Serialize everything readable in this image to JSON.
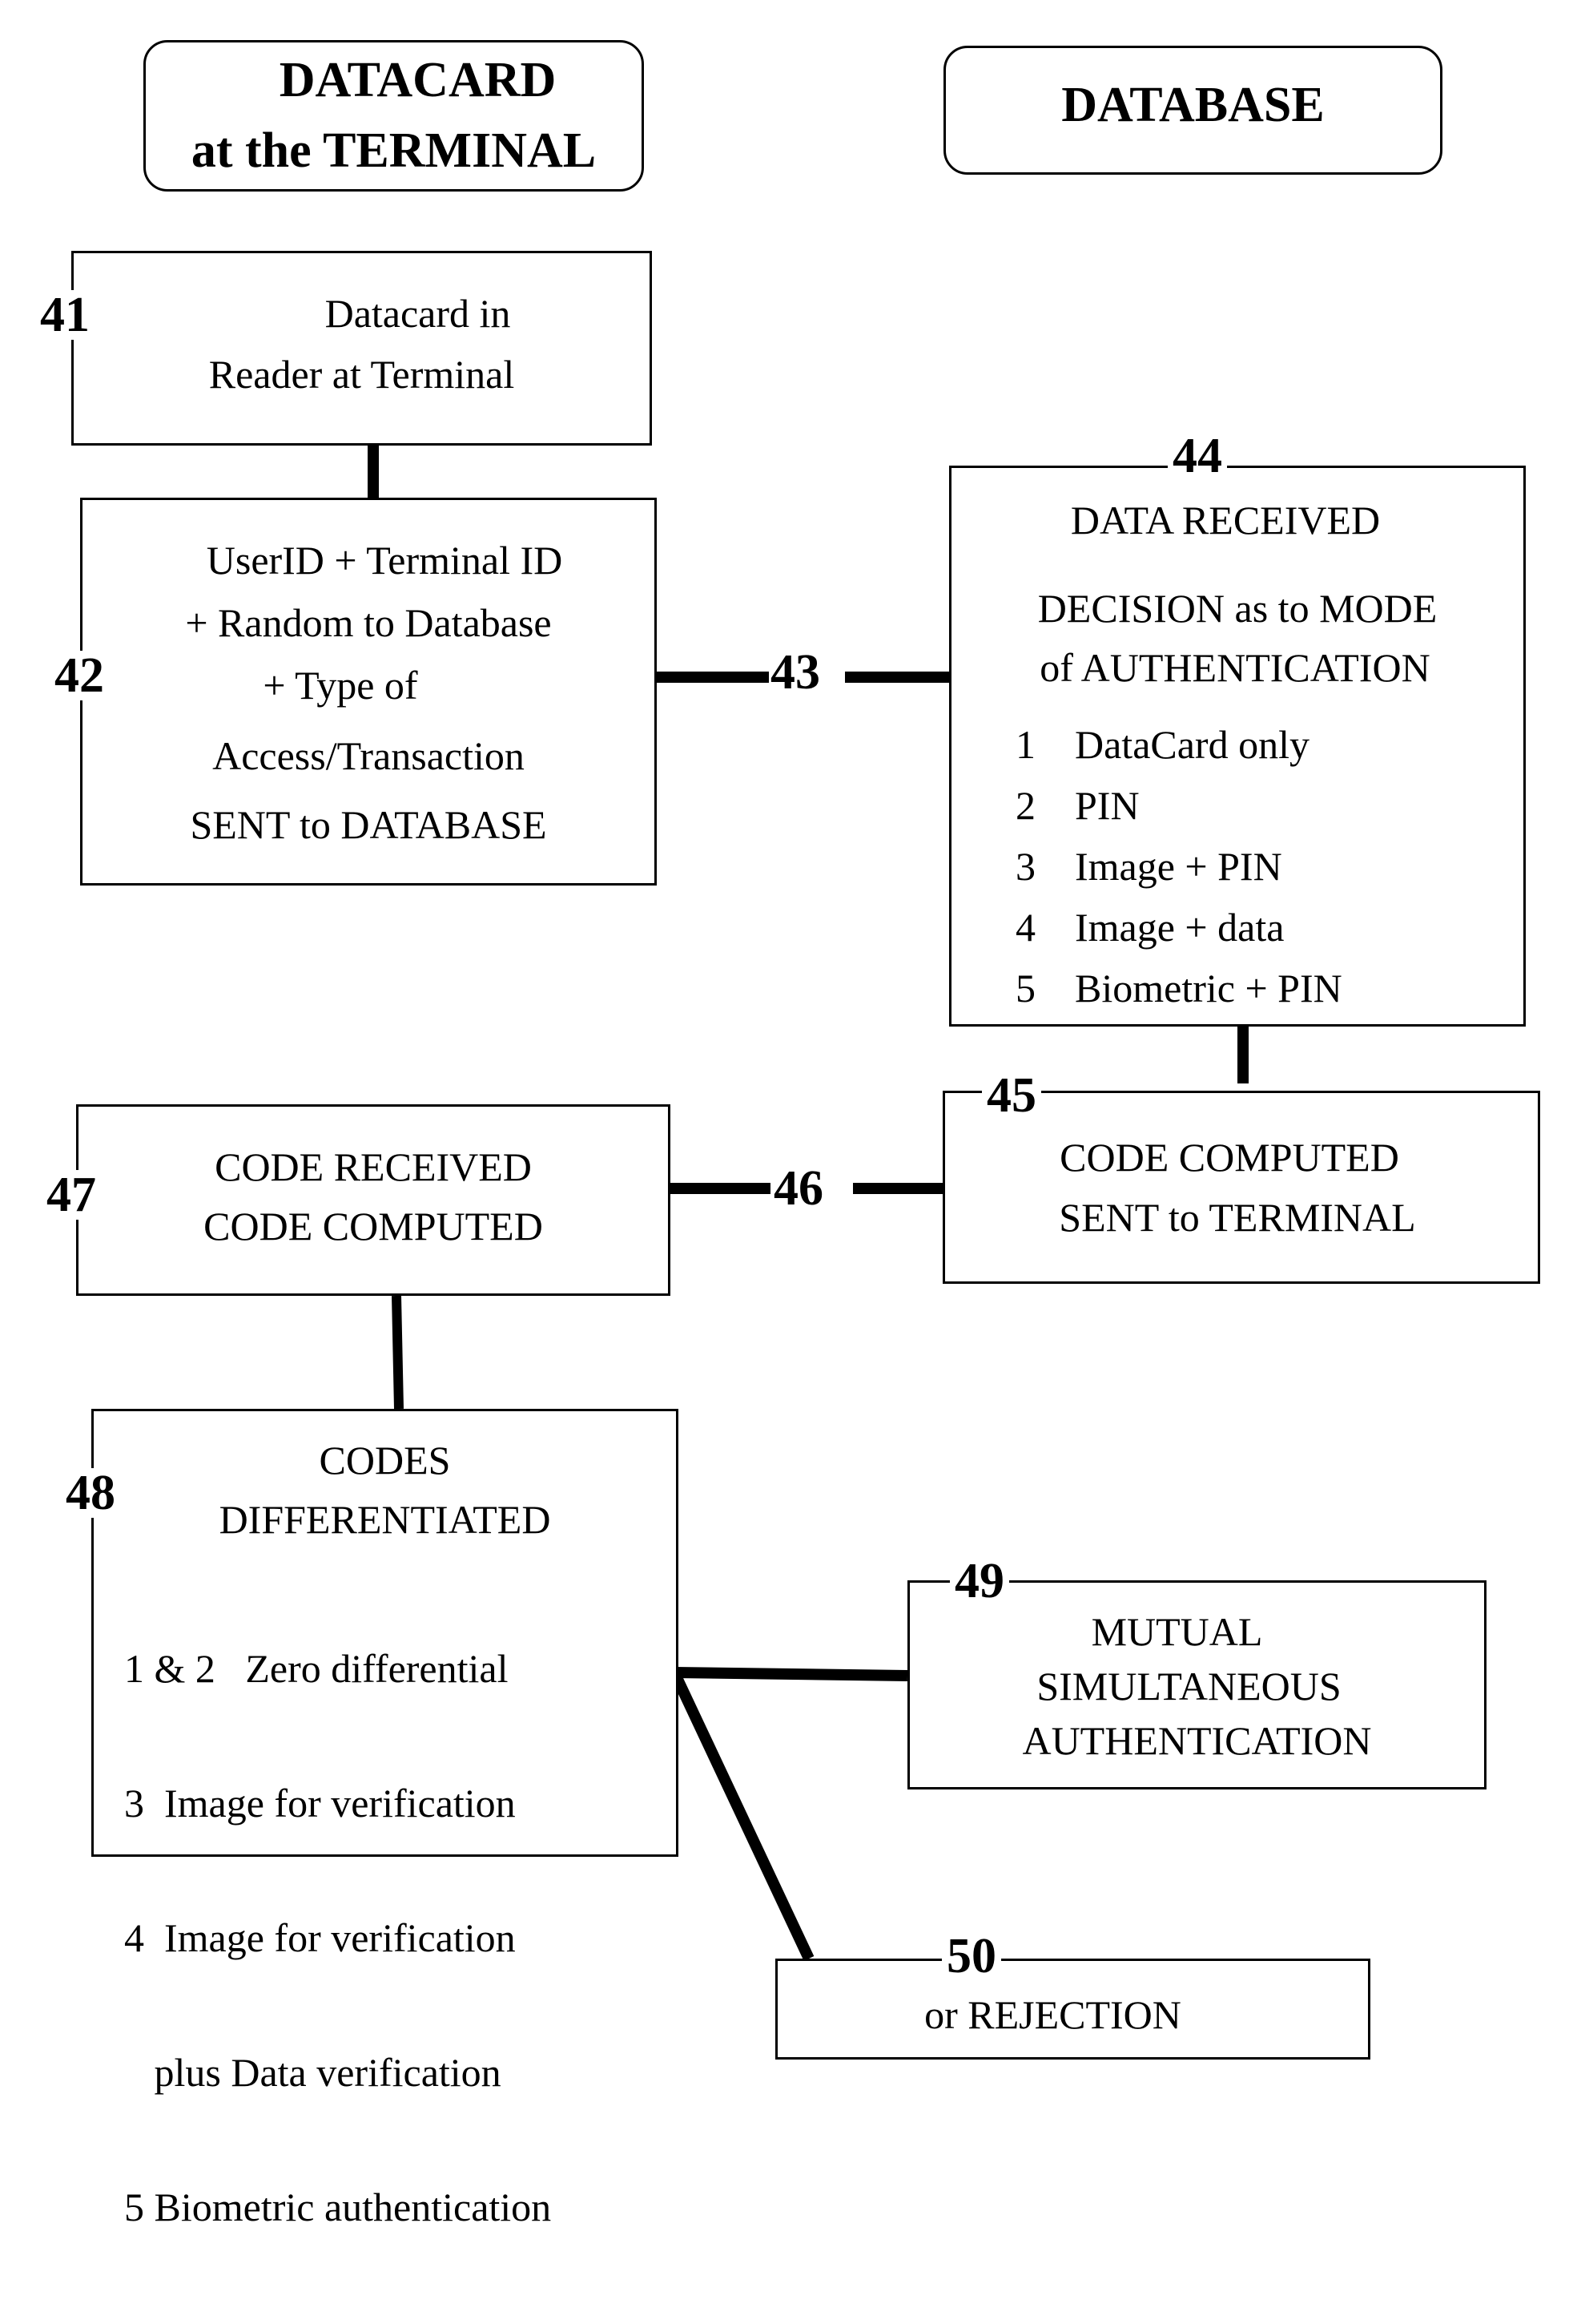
{
  "headers": {
    "left": [
      "DATACARD",
      "at the TERMINAL"
    ],
    "right": "DATABASE"
  },
  "steps": {
    "s41": {
      "label": "41",
      "lines": [
        "Datacard in",
        "Reader at Terminal"
      ]
    },
    "s42": {
      "label": "42",
      "lines": [
        "UserID + Terminal ID",
        "+ Random to Database",
        "+ Type of",
        "Access/Transaction",
        "SENT to DATABASE"
      ]
    },
    "s43": {
      "label": "43"
    },
    "s44": {
      "label": "44",
      "title": "DATA RECEIVED",
      "lines": [
        "DECISION as to MODE",
        "of AUTHENTICATION"
      ],
      "modes": [
        {
          "num": "1",
          "text": "DataCard only"
        },
        {
          "num": "2",
          "text": "PIN"
        },
        {
          "num": "3",
          "text": "Image + PIN"
        },
        {
          "num": "4",
          "text": "Image + data"
        },
        {
          "num": "5",
          "text": "Biometric + PIN"
        }
      ]
    },
    "s45": {
      "label": "45",
      "lines": [
        "CODE COMPUTED",
        "SENT to TERMINAL"
      ]
    },
    "s46": {
      "label": "46"
    },
    "s47": {
      "label": "47",
      "lines": [
        "CODE RECEIVED",
        "CODE COMPUTED"
      ]
    },
    "s48": {
      "label": "48",
      "title": [
        "CODES",
        "DIFFERENTIATED"
      ],
      "items": [
        "1 & 2   Zero differential",
        "3  Image for verification",
        "4  Image for verification",
        "   plus Data verification",
        "5 Biometric authentication"
      ]
    },
    "s49": {
      "label": "49",
      "lines": [
        "MUTUAL",
        "SIMULTANEOUS",
        "AUTHENTICATION"
      ]
    },
    "s50": {
      "label": "50",
      "lines": [
        "or REJECTION"
      ]
    }
  }
}
